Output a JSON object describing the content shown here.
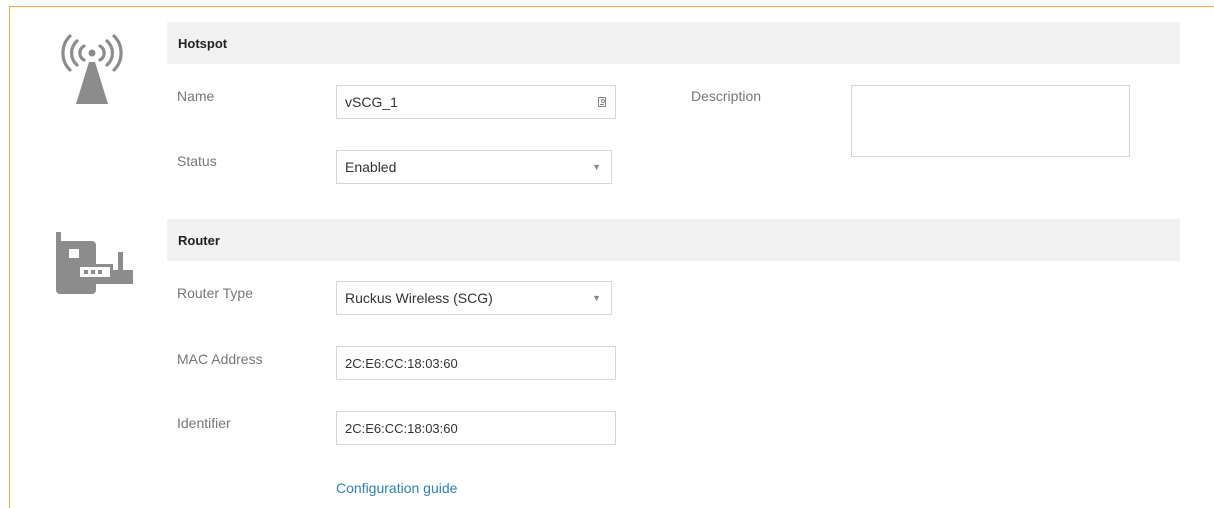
{
  "hotspot": {
    "title": "Hotspot",
    "icon": "wifi-tower-icon",
    "name_label": "Name",
    "name_value": "vSCG_1",
    "description_label": "Description",
    "description_value": "",
    "status_label": "Status",
    "status_value": "Enabled"
  },
  "router": {
    "title": "Router",
    "icon": "router-icon",
    "type_label": "Router Type",
    "type_value": "Ruckus Wireless (SCG)",
    "mac_label": "MAC Address",
    "mac_value": "2C:E6:CC:18:03:60",
    "identifier_label": "Identifier",
    "identifier_value": "2C:E6:CC:18:03:60",
    "config_link": "Configuration guide"
  },
  "colors": {
    "frame_accent": "#f0a64a",
    "header_bg": "#f1f1f1",
    "icon_gray": "#8c8c8c",
    "link": "#2f7fc1"
  }
}
